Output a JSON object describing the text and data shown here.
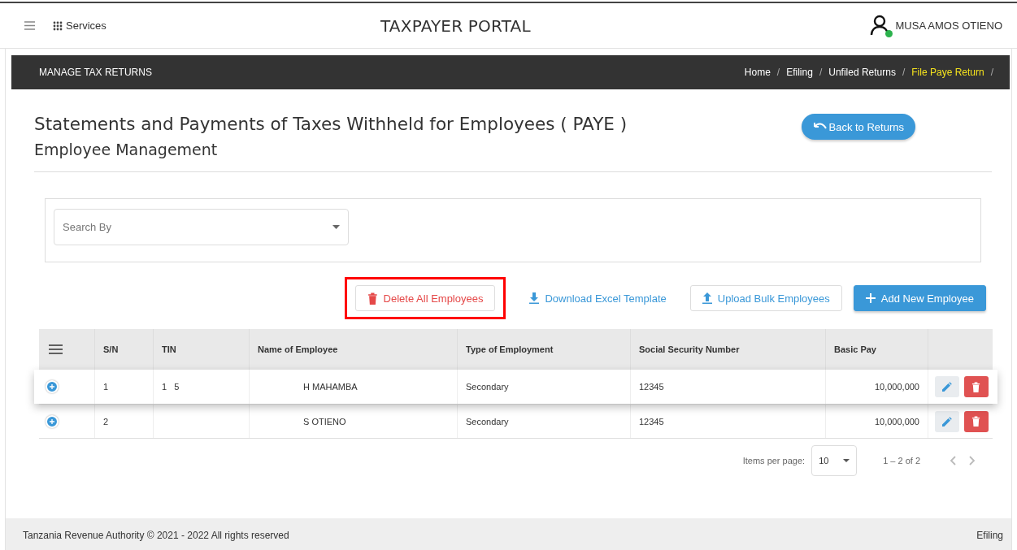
{
  "header": {
    "services_label": "Services",
    "title": "TAXPAYER PORTAL",
    "user_name": "MUSA AMOS OTIENO",
    "user_online": true
  },
  "nav_bar": {
    "title": "MANAGE TAX RETURNS",
    "breadcrumbs": [
      {
        "label": "Home",
        "current": false
      },
      {
        "label": "Efiling",
        "current": false
      },
      {
        "label": "Unfiled Returns",
        "current": false
      },
      {
        "label": "File Paye Return",
        "current": true
      }
    ],
    "separator": "/"
  },
  "page": {
    "title": "Statements and Payments of Taxes Withheld for Employees ( PAYE )",
    "subtitle": "Employee Management",
    "back_button": "Back to Returns"
  },
  "search": {
    "placeholder": "Search By"
  },
  "actions": [
    {
      "kind": "danger",
      "label": "Delete All Employees",
      "marked": true
    },
    {
      "kind": "link",
      "label": "Download Excel Template",
      "marked": false
    },
    {
      "kind": "outline",
      "label": "Upload Bulk Employees",
      "marked": false
    },
    {
      "kind": "primary",
      "label": "Add New Employee",
      "marked": false
    }
  ],
  "table": {
    "columns": [
      "S/N",
      "TIN",
      "Name of Employee",
      "Type of Employment",
      "Social Security Number",
      "Basic Pay"
    ],
    "rows": [
      {
        "sn": "1",
        "tin": "1   5",
        "name": "H MAHAMBA",
        "type": "Secondary",
        "ssn": "12345",
        "basic_pay": "10,000,000",
        "highlighted": true
      },
      {
        "sn": "2",
        "tin": "",
        "name": "S OTIENO",
        "type": "Secondary",
        "ssn": "12345",
        "basic_pay": "10,000,000",
        "highlighted": false
      }
    ]
  },
  "paginator": {
    "label": "Items per page:",
    "page_size": "10",
    "range": "1 – 2 of 2"
  },
  "footer": {
    "copyright": "Tanzania Revenue Authority © 2021 - 2022 All rights reserved",
    "right": "Efiling"
  }
}
